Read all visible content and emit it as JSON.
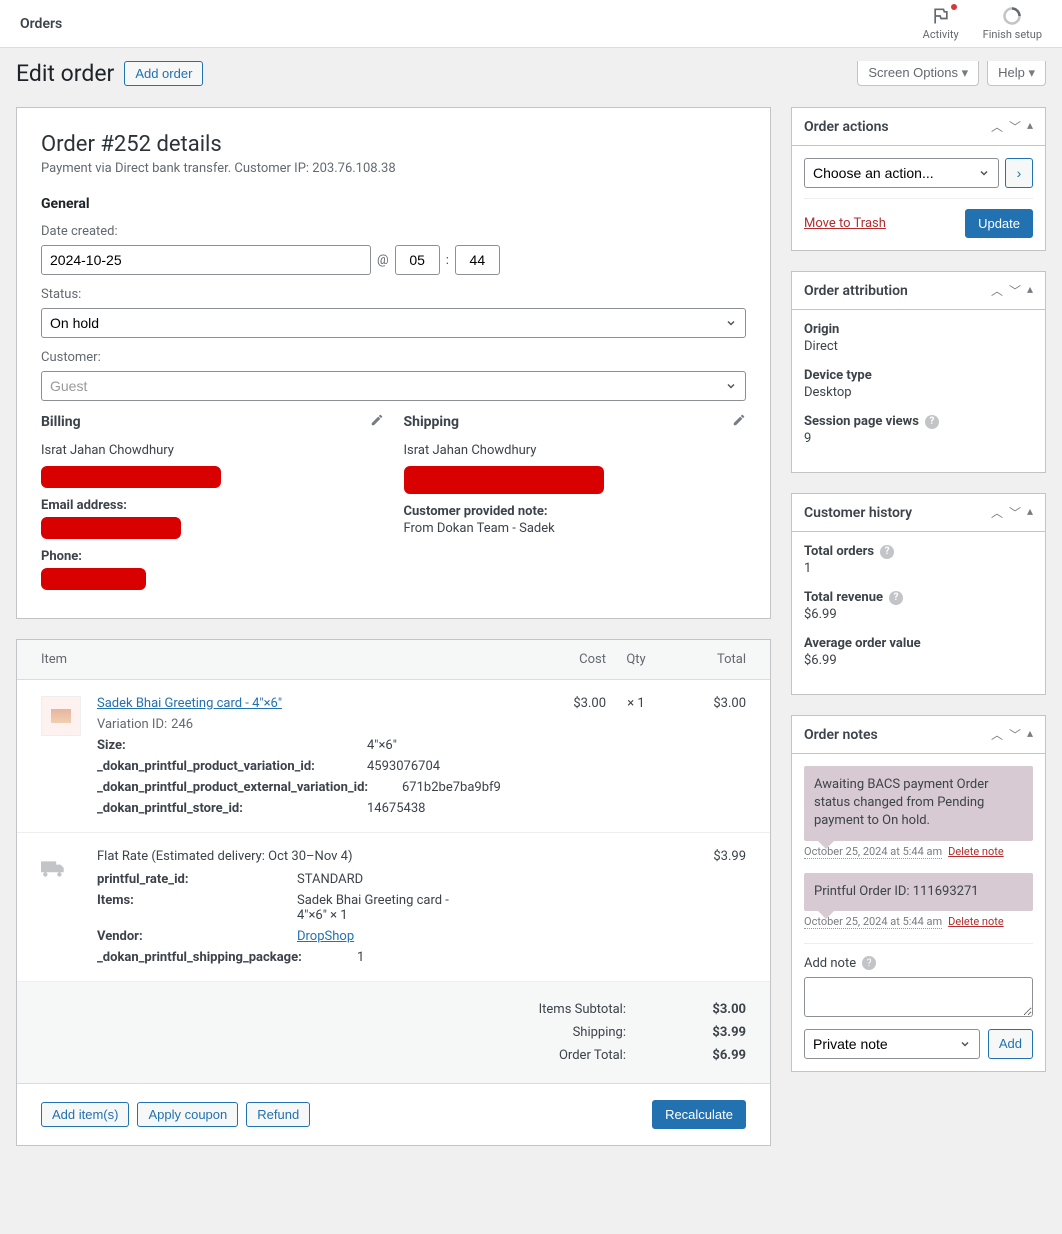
{
  "topbar": {
    "title": "Orders",
    "activity": "Activity",
    "finish_setup": "Finish setup"
  },
  "header": {
    "page_title": "Edit order",
    "add_order": "Add order",
    "screen_options": "Screen Options",
    "help": "Help"
  },
  "order": {
    "title": "Order #252 details",
    "subtitle": "Payment via Direct bank transfer. Customer IP: 203.76.108.38",
    "general_heading": "General",
    "date_label": "Date created:",
    "date_value": "2024-10-25",
    "at": "@",
    "hour": "05",
    "colon": ":",
    "minute": "44",
    "status_label": "Status:",
    "status_value": "On hold",
    "customer_label": "Customer:",
    "customer_value": "Guest",
    "billing": {
      "heading": "Billing",
      "name": "Israt Jahan Chowdhury",
      "email_label": "Email address:",
      "phone_label": "Phone:"
    },
    "shipping": {
      "heading": "Shipping",
      "name": "Israt Jahan Chowdhury",
      "note_label": "Customer provided note:",
      "note_value": "From Dokan Team - Sadek"
    }
  },
  "items": {
    "col_item": "Item",
    "col_cost": "Cost",
    "col_qty": "Qty",
    "col_total": "Total",
    "product": {
      "name": "Sadek Bhai Greeting card - 4″×6″",
      "variation_label": "Variation ID:",
      "variation_id": "246",
      "size_label": "Size:",
      "size": "4″×6″",
      "pv_label": "_dokan_printful_product_variation_id:",
      "pv_val": "4593076704",
      "pev_label": "_dokan_printful_product_external_variation_id:",
      "pev_val": "671b2be7ba9bf9",
      "store_label": "_dokan_printful_store_id:",
      "store_val": "14675438",
      "cost": "$3.00",
      "qty": "× 1",
      "total": "$3.00"
    },
    "shipping": {
      "title": "Flat Rate (Estimated delivery: Oct 30–Nov 4)",
      "rate_label": "printful_rate_id:",
      "rate_val": "STANDARD",
      "items_label": "Items:",
      "items_val": "Sadek Bhai Greeting card - 4″×6″ × 1",
      "vendor_label": "Vendor:",
      "vendor_val": "DropShop",
      "pkg_label": "_dokan_printful_shipping_package:",
      "pkg_val": "1",
      "total": "$3.99"
    },
    "totals": {
      "subtotal_label": "Items Subtotal:",
      "subtotal": "$3.00",
      "shipping_label": "Shipping:",
      "shipping": "$3.99",
      "order_label": "Order Total:",
      "order": "$6.99"
    },
    "actions": {
      "add_items": "Add item(s)",
      "apply_coupon": "Apply coupon",
      "refund": "Refund",
      "recalculate": "Recalculate"
    }
  },
  "side_actions": {
    "heading": "Order actions",
    "choose": "Choose an action...",
    "trash": "Move to Trash",
    "update": "Update"
  },
  "side_attribution": {
    "heading": "Order attribution",
    "origin_label": "Origin",
    "origin": "Direct",
    "device_label": "Device type",
    "device": "Desktop",
    "views_label": "Session page views",
    "views": "9"
  },
  "side_history": {
    "heading": "Customer history",
    "orders_label": "Total orders",
    "orders": "1",
    "revenue_label": "Total revenue",
    "revenue": "$6.99",
    "avg_label": "Average order value",
    "avg": "$6.99"
  },
  "side_notes": {
    "heading": "Order notes",
    "note1": "Awaiting BACS payment Order status changed from Pending payment to On hold.",
    "note1_time": "October 25, 2024 at 5:44 am",
    "note2": "Printful Order ID: 111693271",
    "note2_time": "October 25, 2024 at 5:44 am",
    "delete": "Delete note",
    "add_label": "Add note",
    "note_type": "Private note",
    "add_btn": "Add"
  }
}
